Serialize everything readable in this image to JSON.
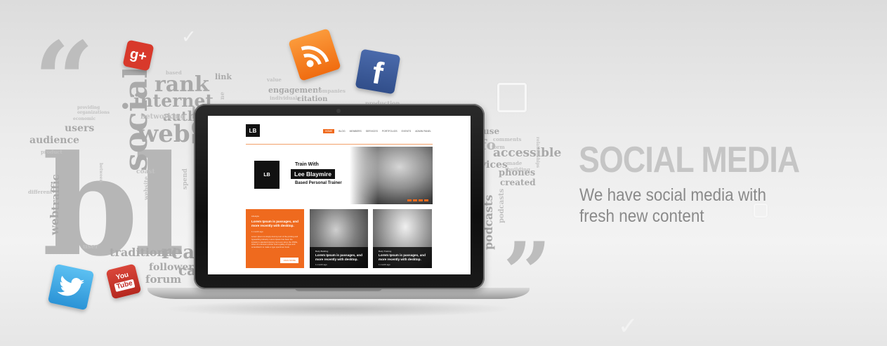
{
  "heading": "SOCIAL MEDIA",
  "subheading_lines": [
    "We have social media with",
    "fresh new content"
  ],
  "colors": {
    "accent": "#ef6a1e",
    "facebook": "#3b5998",
    "twitter": "#3fa6e8",
    "rss": "#f57e1c",
    "googleplus": "#d8392b",
    "youtube": "#c4302b"
  },
  "icons": [
    "googleplus-icon",
    "rss-icon",
    "facebook-icon",
    "twitter-icon",
    "youtube-icon"
  ],
  "word_cloud": {
    "words": [
      "rank",
      "internet",
      "social",
      "web",
      "authority",
      "users",
      "networking",
      "link",
      "based",
      "value",
      "engagement",
      "companies",
      "individuals",
      "citation",
      "production",
      "economic",
      "organizations",
      "providing",
      "audience",
      "traffic",
      "between",
      "coast",
      "spend",
      "website",
      "different",
      "presence",
      "product",
      "traditional",
      "user",
      "followers",
      "forum",
      "reach",
      "comments",
      "accessible",
      "phones",
      "created",
      "made",
      "building",
      "podcasts",
      "use",
      "form",
      "relationships",
      "vices",
      "fo",
      "cations",
      "ne",
      "ia",
      "bl"
    ],
    "quote_open": "“",
    "quote_close": "”"
  },
  "icon_labels": {
    "googleplus": "g+",
    "facebook": "f",
    "youtube_top": "You",
    "youtube_bottom": "Tube"
  },
  "screen_site": {
    "logo_text": "LB",
    "nav": [
      "HOME",
      "BLOG",
      "MEMBERS",
      "SERVICES",
      "PORTFOLIOS",
      "EVENTS",
      "ADMIN PANEL"
    ],
    "hero": {
      "line1": "Train With",
      "line2": "Lee Blaymire",
      "line3": "Based Personal Trainer",
      "logo_text": "LB"
    },
    "cards": [
      {
        "tag": "Lifestyle",
        "title": "Lorem Ipsum is passages, and more recently with desktop.",
        "meta": "1 month ago",
        "body": "Lorem Ipsum is simply dummy text of the printing and typesetting industry. Lorem Ipsum has been the industry's standard dummy text ever since the 1500s, when an unknown printer took a galley of type and scrambled it to make a type specimen book.",
        "button": "VIEW MORE"
      },
      {
        "tag": "Body Building",
        "title": "Lorem Ipsum is passages, and more recently with desktop.",
        "meta": "1 month ago"
      },
      {
        "tag": "Body Training",
        "title": "Lorem Ipsum is passages, and more recently with desktop.",
        "meta": "1 month ago"
      }
    ]
  }
}
